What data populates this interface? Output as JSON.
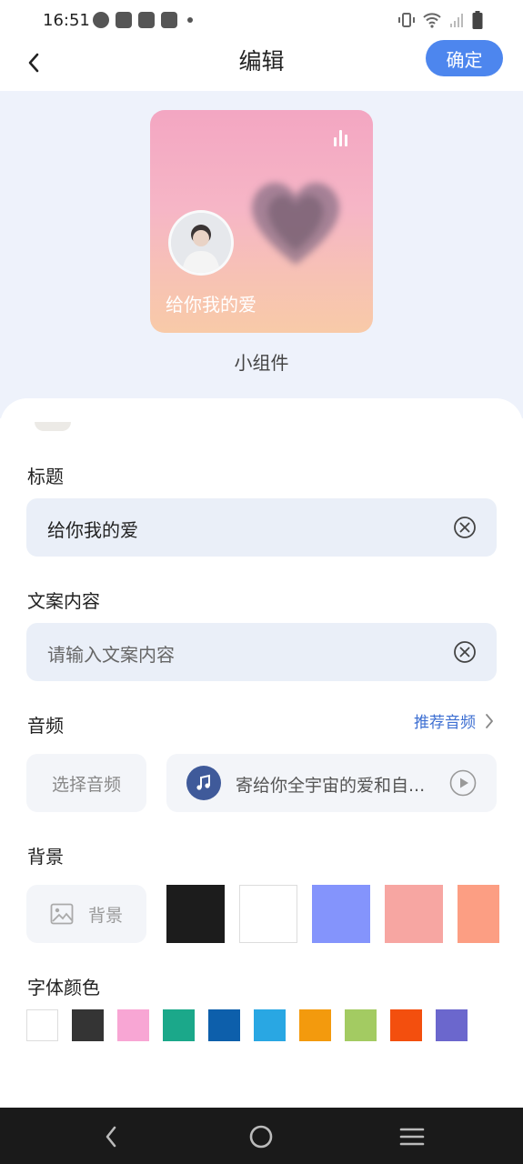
{
  "status_bar": {
    "time": "16:51",
    "left_icons": [
      "speedometer-icon",
      "shopping-bag-icon",
      "shopping-bag-icon",
      "shopping-bag-icon",
      "dot-icon"
    ],
    "right_icons": [
      "vibrate-icon",
      "wifi-icon",
      "signal-icon",
      "battery-icon"
    ]
  },
  "header": {
    "title": "编辑",
    "confirm_label": "确定",
    "back_icon": "chevron-left-icon"
  },
  "preview": {
    "widget_title": "给你我的爱",
    "caption": "小组件",
    "corner_icon": "equalizer-icon"
  },
  "form": {
    "title": {
      "label": "标题",
      "value": "给你我的爱"
    },
    "copy": {
      "label": "文案内容",
      "placeholder": "请输入文案内容"
    },
    "audio": {
      "label": "音频",
      "recommend_label": "推荐音频",
      "select_label": "选择音频",
      "current_track": "寄给你全宇宙的爱和自..."
    },
    "background": {
      "label": "背景",
      "pick_label": "背景",
      "swatches": [
        "#1c1c1c",
        "#ffffff",
        "#8494fc",
        "#f7a6a2",
        "#fc9e83"
      ]
    },
    "font_color": {
      "label": "字体颜色",
      "swatches": [
        "#ffffff",
        "#343434",
        "#f8a6d4",
        "#1ba88a",
        "#0d5fab",
        "#29a7e3",
        "#f39a0d",
        "#a3cb62",
        "#f34f0e",
        "#6b67cd"
      ]
    }
  },
  "colors": {
    "accent": "#4d86ee",
    "link": "#3d6fd2",
    "field_bg": "#eaeff8",
    "preview_bg": "#eef2fb"
  }
}
